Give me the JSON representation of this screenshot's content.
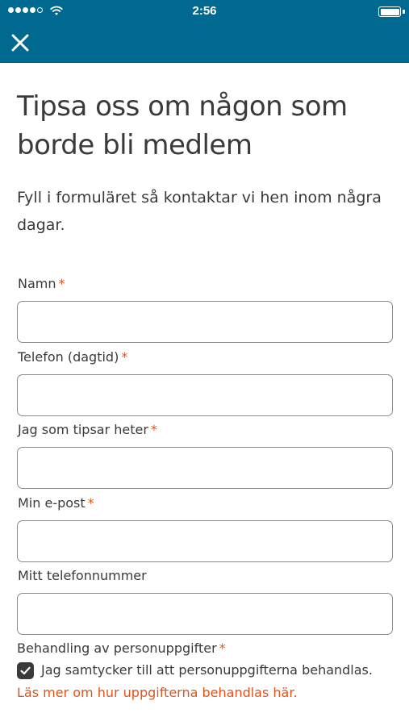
{
  "status_bar": {
    "time": "2:56",
    "signal_strength": "4 of 5 dots",
    "icons": [
      "signal-icon",
      "wifi-icon",
      "battery-icon"
    ]
  },
  "nav": {
    "close_icon": "close-icon",
    "background_color": "#00698f"
  },
  "page": {
    "title": "Tipsa oss om någon som borde bli medlem",
    "intro": "Fyll i formuläret så kontaktar vi hen inom några dagar."
  },
  "form": {
    "required_marker": "*",
    "fields": [
      {
        "label": "Namn",
        "required": true,
        "value": ""
      },
      {
        "label": "Telefon (dagtid)",
        "required": true,
        "value": ""
      },
      {
        "label": "Jag som tipsar heter",
        "required": true,
        "value": ""
      },
      {
        "label": "Min e-post",
        "required": true,
        "value": ""
      },
      {
        "label": "Mitt telefonnummer",
        "required": false,
        "value": ""
      }
    ]
  },
  "consent": {
    "heading": "Behandling av personuppgifter",
    "required": true,
    "checkbox_checked": true,
    "checkbox_label": "Jag samtycker till att personuppgifterna behandlas.",
    "link_text": "Läs mer om hur uppgifterna behandlas här."
  },
  "colors": {
    "accent": "#00698f",
    "required": "#e0541b",
    "link": "#e0541b",
    "text": "#3a3a3a"
  }
}
